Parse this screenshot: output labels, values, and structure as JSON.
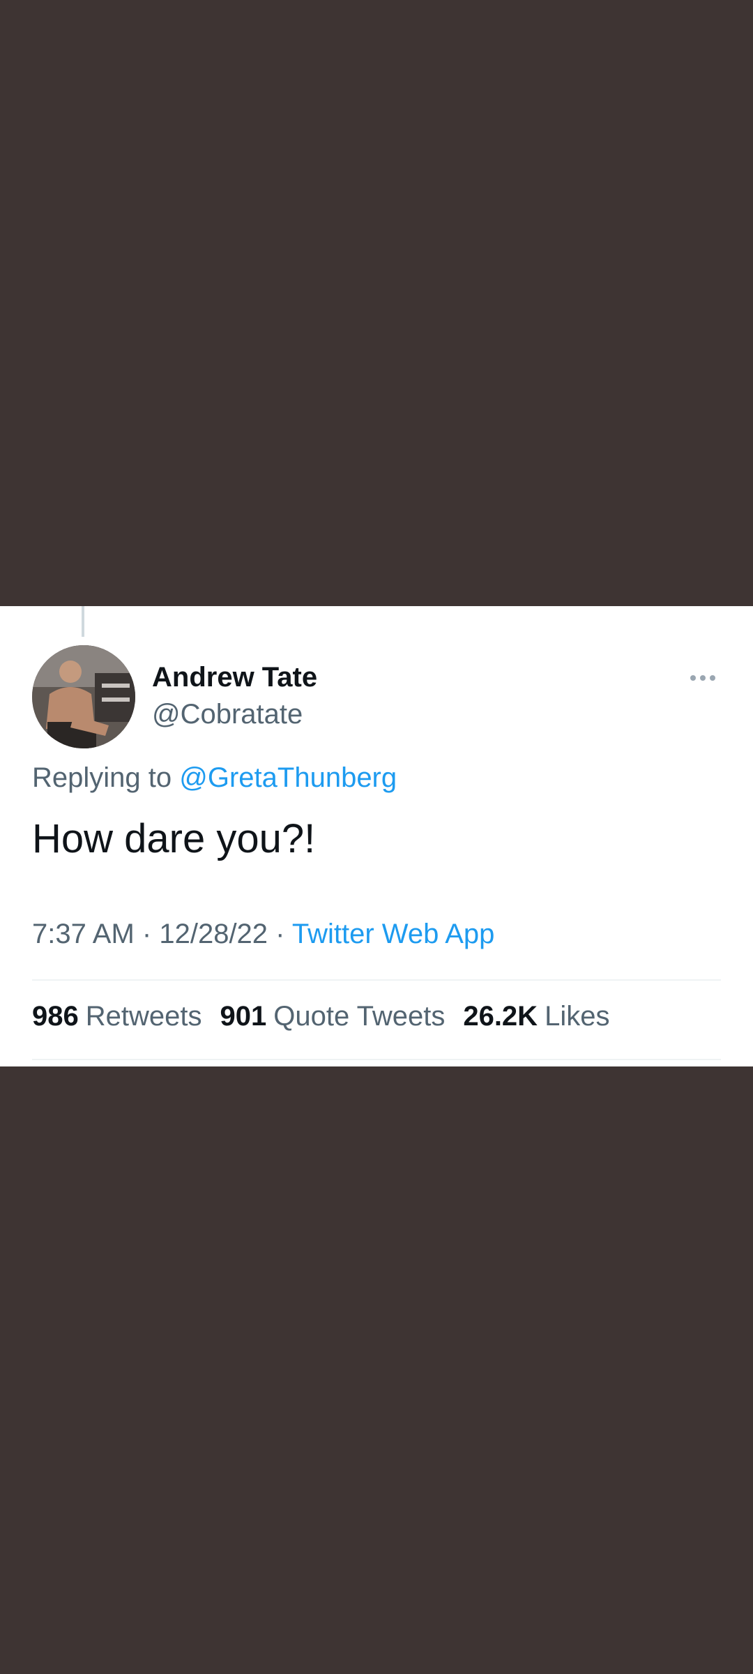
{
  "tweet": {
    "author_name": "Andrew Tate",
    "author_handle": "@Cobratate",
    "replying_prefix": "Replying to",
    "replying_to": "@GretaThunberg",
    "text": "How dare you?!",
    "time": "7:37 AM",
    "date": "12/28/22",
    "separator": "·",
    "source": "Twitter Web App"
  },
  "stats": {
    "retweets_count": "986",
    "retweets_label": "Retweets",
    "quotes_count": "901",
    "quotes_label": "Quote Tweets",
    "likes_count": "26.2K",
    "likes_label": "Likes"
  },
  "colors": {
    "background": "#3e3433",
    "card": "#ffffff",
    "link": "#1d9bf0",
    "primary_text": "#0f1419",
    "secondary_text": "#536471"
  },
  "icons": {
    "more": "more-horizontal-icon"
  }
}
